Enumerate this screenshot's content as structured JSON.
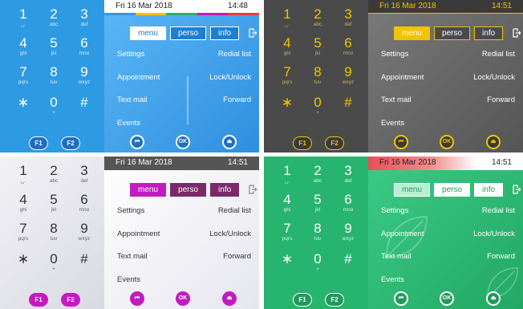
{
  "status": {
    "date": "Fri 16 Mar 2018"
  },
  "times": [
    "14:48",
    "14:51",
    "14:51",
    "14:51"
  ],
  "keypad": [
    {
      "digit": "1",
      "letters": "␣."
    },
    {
      "digit": "2",
      "letters": "abc"
    },
    {
      "digit": "3",
      "letters": "def"
    },
    {
      "digit": "4",
      "letters": "ghi"
    },
    {
      "digit": "5",
      "letters": "jkl"
    },
    {
      "digit": "6",
      "letters": "mno"
    },
    {
      "digit": "7",
      "letters": "pqrs"
    },
    {
      "digit": "8",
      "letters": "tuv"
    },
    {
      "digit": "9",
      "letters": "wxyz"
    },
    {
      "digit": "∗",
      "letters": ""
    },
    {
      "digit": "0",
      "letters": "+"
    },
    {
      "digit": "#",
      "letters": ""
    }
  ],
  "fkeys": [
    "F1",
    "F2"
  ],
  "tabs": [
    "menu",
    "perso",
    "info"
  ],
  "menu": {
    "settings": "Settings",
    "appointment": "Appointment",
    "text_mail": "Text mail",
    "events": "Events",
    "redial": "Redial list",
    "lock": "Lock/Unlock",
    "forward": "Forward"
  },
  "nav": {
    "prev": "⏮",
    "ok": "OK",
    "home": "⏏"
  },
  "themes": [
    {
      "name": "blue",
      "keypad_bg": "#2f9ae4",
      "screen_bg": "#4aaaf0",
      "accent": "#ffffff",
      "text": "#ffffff",
      "tab_bg": "#1e7fd0"
    },
    {
      "name": "gold",
      "keypad_bg": "#4a4a4a",
      "screen_bg": "#6a6a6a",
      "accent": "#f2c400",
      "text": "#ffffff",
      "tab_bg": "#f2c400"
    },
    {
      "name": "purple",
      "keypad_bg": "#e9e9ef",
      "screen_bg": "#ffffff",
      "accent": "#c21bbf",
      "text": "#333333",
      "tab_bg": "#7a2a6a"
    },
    {
      "name": "green",
      "keypad_bg": "#27b46e",
      "screen_bg": "#35c57e",
      "accent": "#ffffff",
      "text": "#ffffff",
      "tab_bg": "#1f9a5c"
    }
  ]
}
